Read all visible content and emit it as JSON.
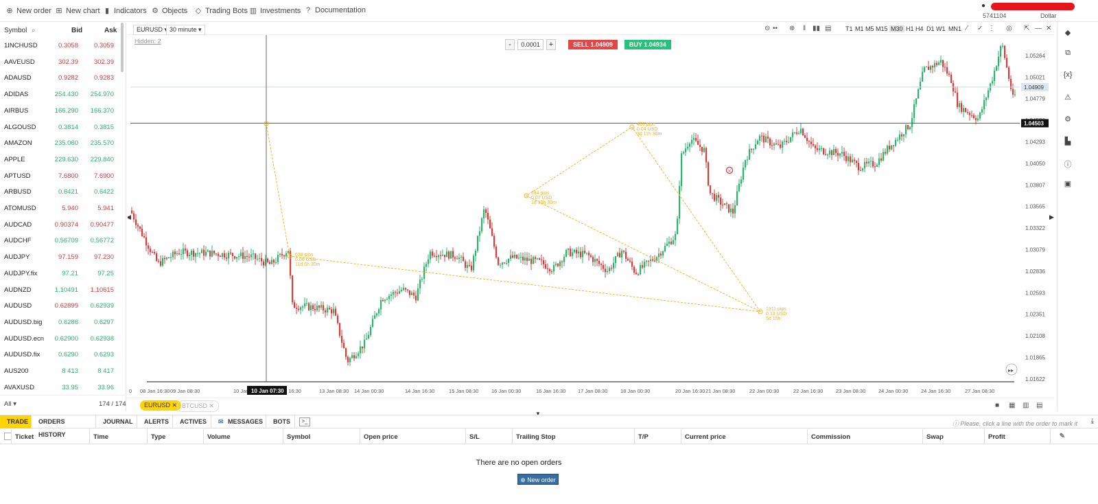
{
  "topbar": {
    "items": [
      {
        "icon": "plus-circle-icon",
        "label": "New order"
      },
      {
        "icon": "new-chart-icon",
        "label": "New chart"
      },
      {
        "icon": "indicators-icon",
        "label": "Indicators"
      },
      {
        "icon": "objects-icon",
        "label": "Objects"
      },
      {
        "icon": "bots-icon",
        "label": "Trading Bots"
      },
      {
        "icon": "investments-icon",
        "label": "Investments"
      },
      {
        "icon": "help-circle-icon",
        "label": "Documentation"
      }
    ],
    "account_number": "5741104",
    "currency": "Dollar"
  },
  "sidebar": {
    "col_symbol": "Symbol",
    "col_bid": "Bid",
    "col_ask": "Ask",
    "rows": [
      {
        "symbol": "1INCHUSD",
        "bid": "0.3058",
        "ask": "0.3059",
        "dir": "dn"
      },
      {
        "symbol": "AAVEUSD",
        "bid": "302.39",
        "ask": "302.39",
        "dir": "dn"
      },
      {
        "symbol": "ADAUSD",
        "bid": "0.9282",
        "ask": "0.9283",
        "dir": "dn"
      },
      {
        "symbol": "ADIDAS",
        "bid": "254.430",
        "ask": "254.970",
        "dir": "up"
      },
      {
        "symbol": "AIRBUS",
        "bid": "166.290",
        "ask": "166.370",
        "dir": "up"
      },
      {
        "symbol": "ALGOUSD",
        "bid": "0.3814",
        "ask": "0.3815",
        "dir": "up"
      },
      {
        "symbol": "AMAZON",
        "bid": "235.060",
        "ask": "235.570",
        "dir": "up"
      },
      {
        "symbol": "APPLE",
        "bid": "229.630",
        "ask": "229.840",
        "dir": "up"
      },
      {
        "symbol": "APTUSD",
        "bid": "7.6800",
        "ask": "7.6900",
        "dir": "dn"
      },
      {
        "symbol": "ARBUSD",
        "bid": "0.6421",
        "ask": "0.6422",
        "dir": "up"
      },
      {
        "symbol": "ATOMUSD",
        "bid": "5.940",
        "ask": "5.941",
        "dir": "dn"
      },
      {
        "symbol": "AUDCAD",
        "bid": "0.90374",
        "ask": "0.90477",
        "dir": "dn"
      },
      {
        "symbol": "AUDCHF",
        "bid": "0.56709",
        "ask": "0.56772",
        "dir": "up"
      },
      {
        "symbol": "AUDJPY",
        "bid": "97.159",
        "ask": "97.230",
        "dir": "dn"
      },
      {
        "symbol": "AUDJPY.fix",
        "bid": "97.21",
        "ask": "97.25",
        "dir": "up"
      },
      {
        "symbol": "AUDNZD",
        "bid": "1.10491",
        "ask": "1.10615",
        "dir": "mixed"
      },
      {
        "symbol": "AUDUSD",
        "bid": "0.62899",
        "ask": "0.62939",
        "dir": "mixed2"
      },
      {
        "symbol": "AUDUSD.big",
        "bid": "0.6286",
        "ask": "0.6297",
        "dir": "up"
      },
      {
        "symbol": "AUDUSD.ecn",
        "bid": "0.62900",
        "ask": "0.62938",
        "dir": "up"
      },
      {
        "symbol": "AUDUSD.fix",
        "bid": "0.6290",
        "ask": "0.6293",
        "dir": "up"
      },
      {
        "symbol": "AUS200",
        "bid": "8 413",
        "ask": "8 417",
        "dir": "up"
      },
      {
        "symbol": "AVAXUSD",
        "bid": "33.95",
        "ask": "33.96",
        "dir": "up"
      }
    ],
    "filter": "All",
    "count": "174 / 174"
  },
  "chart": {
    "symbol": "EURUSD",
    "timeframe": "30 minute",
    "hidden": "Hidden: 2",
    "timeframes": [
      "T1",
      "M1",
      "M5",
      "M15",
      "M30",
      "H1",
      "H4",
      "D1",
      "W1",
      "MN1"
    ],
    "active_tf": "M30",
    "step_minus": "-",
    "step_value": "0.0001",
    "step_plus": "+",
    "sell": "SELL 1.04909",
    "buy": "BUY 1.04934",
    "current_price": "1.04909",
    "hline_price": "1.04503",
    "crosshair_time": "10 Jan 07:30",
    "price_ticks": [
      "1.05264",
      "1.05021",
      "1.04779",
      "1.04536",
      "1.04293",
      "1.04050",
      "1.03807",
      "1.03565",
      "1.03322",
      "1.03079",
      "1.02836",
      "1.02593",
      "1.02351",
      "1.02108",
      "1.01865",
      "1.01622"
    ],
    "time_ticks": [
      "0",
      "08 Jan 16:30",
      "09 Jan 08:30",
      "10 Jan",
      "Jan 16:30",
      "13 Jan 08:30",
      "14 Jan 00:30",
      "14 Jan 16:30",
      "15 Jan 08:30",
      "16 Jan 00:30",
      "16 Jan 16:30",
      "17 Jan 08:30",
      "18 Jan 00:30",
      "20 Jan 16:30",
      "21 Jan 08:30",
      "22 Jan 00:30",
      "22 Jan 16:30",
      "23 Jan 08:30",
      "24 Jan 00:30",
      "24 Jan 16:30",
      "27 Jan 08:30"
    ],
    "annotations": [
      {
        "l1": "628 pips",
        "l2": "0.06 USD",
        "l3": "11d 6h 30m"
      },
      {
        "l1": "784 pips",
        "l2": "0.07 USD",
        "l3": "1d 15h 30m"
      },
      {
        "l1": "466 pips",
        "l2": "0.04 USD",
        "l3": "3d 11h 30m"
      },
      {
        "l1": "1311 pips",
        "l2": "0.13 USD",
        "l3": "5d 15h"
      }
    ],
    "tabs": [
      "EURUSD",
      "BTCUSD"
    ]
  },
  "bottom": {
    "tabs": [
      "TRADE",
      "ORDERS HISTORY",
      "JOURNAL",
      "ALERTS",
      "ACTIVES",
      "MESSAGES",
      "BOTS"
    ],
    "hint": "Please, click a line with the order to mark it",
    "columns": [
      "Ticket",
      "Time",
      "Type",
      "Volume",
      "Symbol",
      "Open price",
      "S/L",
      "Trailing Stop",
      "T/P",
      "Current price",
      "Commission",
      "Swap",
      "Profit"
    ],
    "empty": "There are no open orders",
    "new_order": "New order"
  },
  "colors": {
    "up": "#2ab36b",
    "down": "#d93b3b",
    "accent": "#ffd400",
    "annotation": "#f0b429"
  }
}
